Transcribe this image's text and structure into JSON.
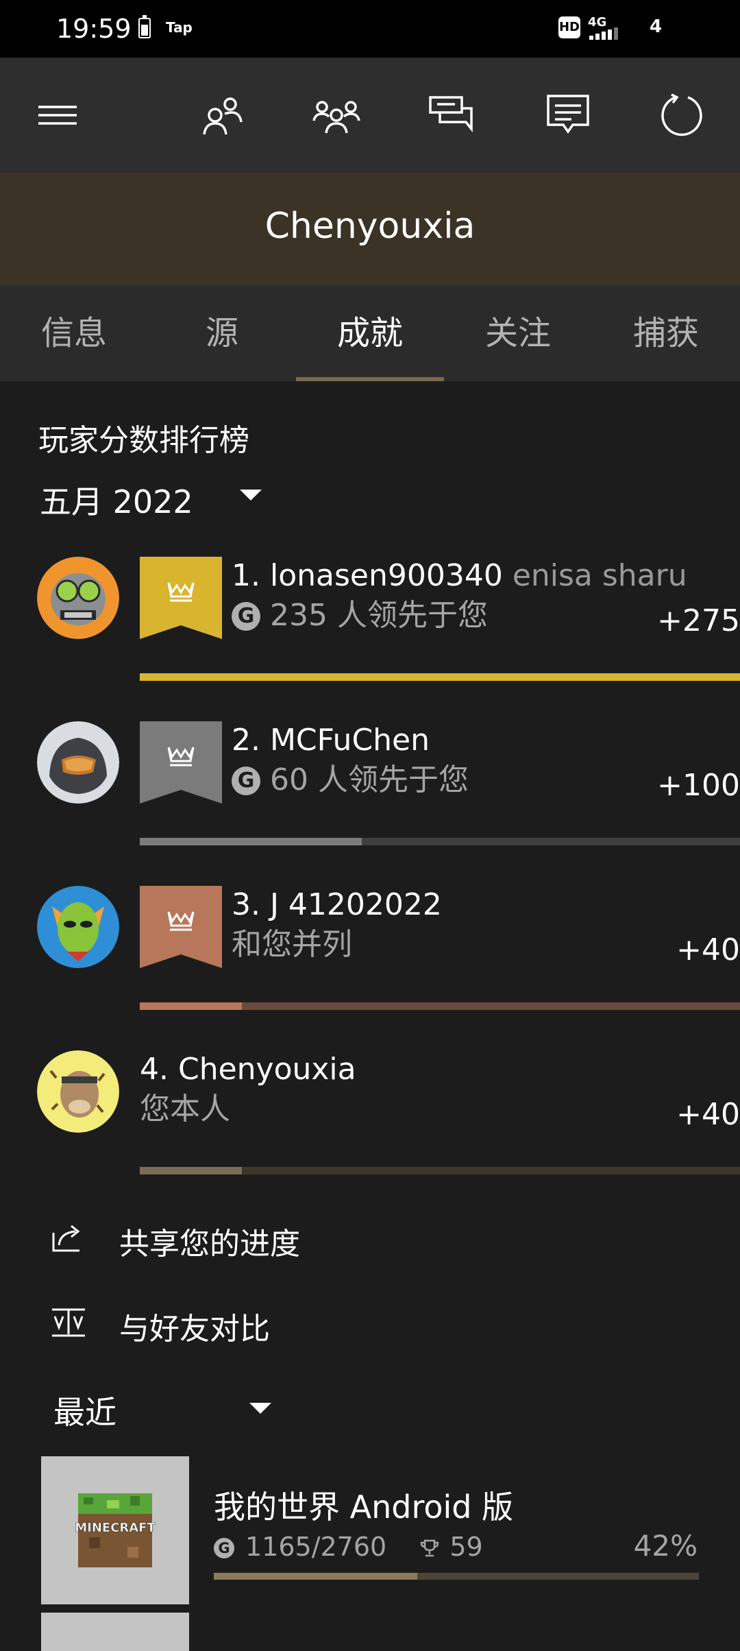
{
  "status_bar": {
    "time": "19:59",
    "tap": "Tap",
    "hd": "HD",
    "network": "4G",
    "count": "4"
  },
  "app": {
    "profile_name": "Chenyouxia"
  },
  "tabs": [
    {
      "label": "信息"
    },
    {
      "label": "源"
    },
    {
      "label": "成就",
      "active": true
    },
    {
      "label": "关注"
    },
    {
      "label": "捕获"
    }
  ],
  "leaderboard": {
    "title": "玩家分数排行榜",
    "month": "五月 2022",
    "entries": [
      {
        "rank_name": "1. lonasen900340",
        "secondary_name": "enisa sharu",
        "subtitle": "235 人领先于您",
        "score": "+275",
        "medal": "gold",
        "medal_color": "#d9b52f",
        "bar_color": "#d9b52f",
        "bar_track": "#d9b52f",
        "progress": 1.0,
        "show_g": true
      },
      {
        "rank_name": "2. MCFuChen",
        "secondary_name": "",
        "subtitle": "60 人领先于您",
        "score": "+100",
        "medal": "silver",
        "medal_color": "#7b7b7b",
        "bar_color": "#7b7b7b",
        "bar_track": "#3f3f3f",
        "progress": 0.37,
        "show_g": true
      },
      {
        "rank_name": "3. J 41202022",
        "secondary_name": "",
        "subtitle": "和您并列",
        "score": "+40",
        "medal": "bronze",
        "medal_color": "#b8775a",
        "bar_color": "#b8775a",
        "bar_track": "#6b4a3c",
        "progress": 0.17,
        "show_g": false
      },
      {
        "rank_name": "4. Chenyouxia",
        "secondary_name": "",
        "subtitle": "您本人",
        "score": "+40",
        "medal": "none",
        "medal_color": "",
        "bar_color": "#7a6c55",
        "bar_track": "#3c362b",
        "progress": 0.17,
        "show_g": false
      }
    ]
  },
  "actions": {
    "share_label": "共享您的进度",
    "compare_label": "与好友对比"
  },
  "recent": {
    "label": "最近",
    "games": [
      {
        "title": "我的世界 Android 版",
        "gamerscore": "1165/2760",
        "trophies": "59",
        "percent": "42%",
        "progress": 0.42,
        "logo_text": "MINECRAFT"
      }
    ]
  }
}
